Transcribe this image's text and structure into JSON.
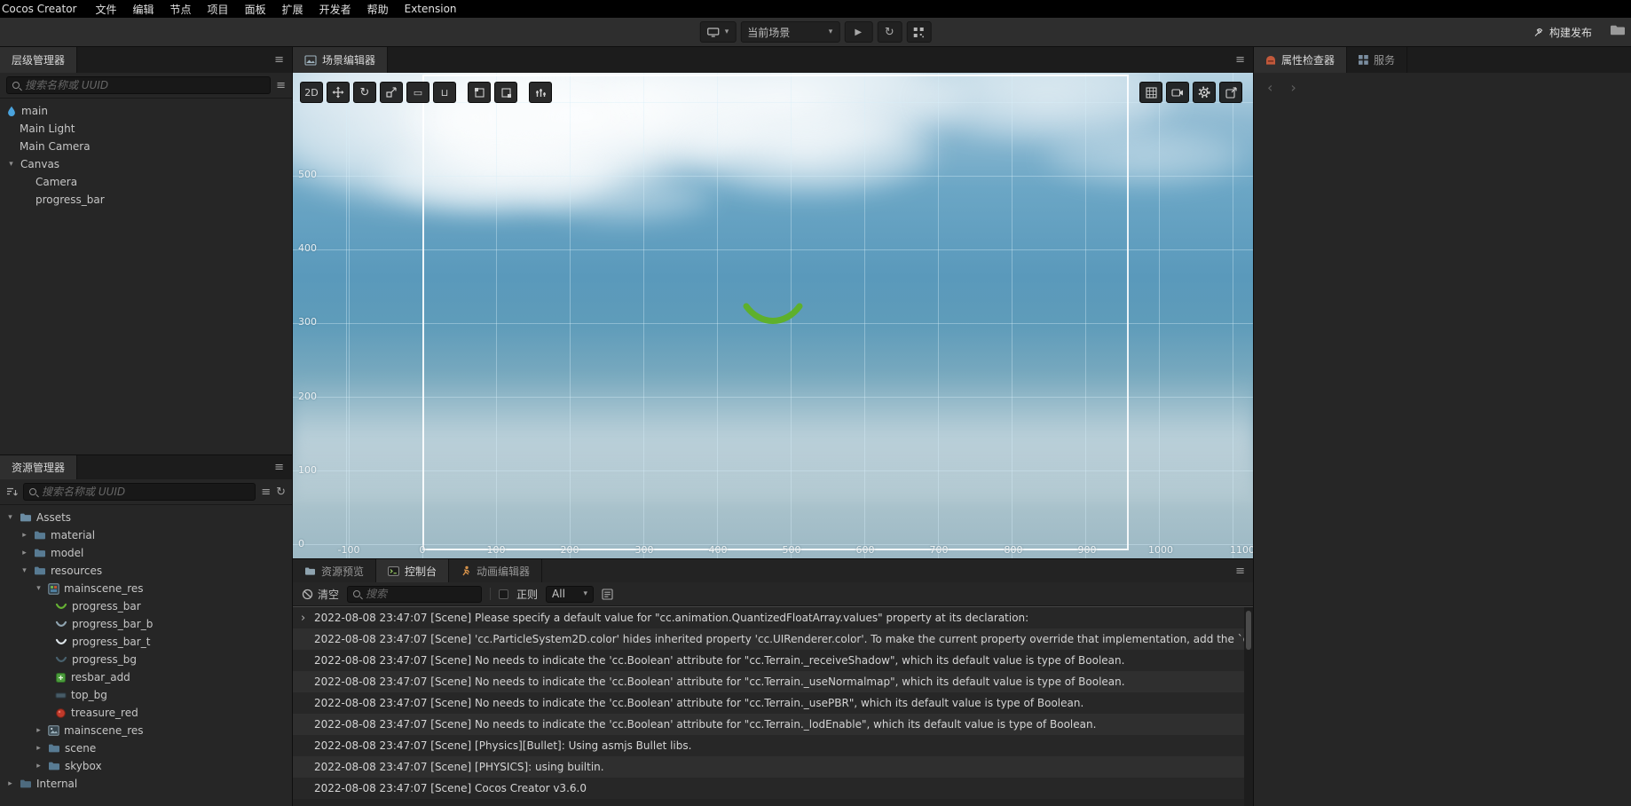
{
  "menubar": {
    "app_name": "Cocos Creator",
    "items": [
      "文件",
      "编辑",
      "节点",
      "项目",
      "面板",
      "扩展",
      "开发者",
      "帮助",
      "Extension"
    ]
  },
  "toolbar": {
    "scene_dropdown_value": "当前场景",
    "build_label": "构建发布"
  },
  "hierarchy": {
    "title": "层级管理器",
    "search_placeholder": "搜索名称或 UUID",
    "nodes": [
      "main",
      "Main Light",
      "Main Camera",
      "Canvas",
      "Camera",
      "progress_bar"
    ]
  },
  "assets": {
    "title": "资源管理器",
    "search_placeholder": "搜索名称或 UUID",
    "items": [
      "Assets",
      "material",
      "model",
      "resources",
      "mainscene_res",
      "progress_bar",
      "progress_bar_b",
      "progress_bar_t",
      "progress_bg",
      "resbar_add",
      "top_bg",
      "treasure_red",
      "mainscene_res",
      "scene",
      "skybox",
      "Internal"
    ]
  },
  "scene": {
    "tab_label": "场景编辑器",
    "mode_2d": "2D",
    "ruler_y": [
      "500",
      "400",
      "300",
      "200",
      "100",
      "0"
    ],
    "ruler_x": [
      "-100",
      "0",
      "100",
      "200",
      "300",
      "400",
      "500",
      "600",
      "700",
      "800",
      "900",
      "1000",
      "1100"
    ]
  },
  "console": {
    "tabs": [
      "资源预览",
      "控制台",
      "动画编辑器"
    ],
    "clear_label": "清空",
    "search_placeholder": "搜索",
    "regex_label": "正则",
    "filter_value": "All",
    "logs": [
      "2022-08-08 23:47:07 [Scene] Please specify a default value for \"cc.animation.QuantizedFloatArray.values\" property at its declaration:",
      "2022-08-08 23:47:07 [Scene] 'cc.ParticleSystem2D.color' hides inherited property 'cc.UIRenderer.color'. To make the current property override that implementation, add the `override: true` attribute plea",
      "2022-08-08 23:47:07 [Scene] No needs to indicate the 'cc.Boolean' attribute for \"cc.Terrain._receiveShadow\", which its default value is type of Boolean.",
      "2022-08-08 23:47:07 [Scene] No needs to indicate the 'cc.Boolean' attribute for \"cc.Terrain._useNormalmap\", which its default value is type of Boolean.",
      "2022-08-08 23:47:07 [Scene] No needs to indicate the 'cc.Boolean' attribute for \"cc.Terrain._usePBR\", which its default value is type of Boolean.",
      "2022-08-08 23:47:07 [Scene] No needs to indicate the 'cc.Boolean' attribute for \"cc.Terrain._lodEnable\", which its default value is type of Boolean.",
      "2022-08-08 23:47:07 [Scene] [Physics][Bullet]: Using asmjs Bullet libs.",
      "2022-08-08 23:47:07 [Scene] [PHYSICS]: using builtin.",
      "2022-08-08 23:47:07 [Scene] Cocos Creator v3.6.0"
    ]
  },
  "inspector": {
    "tabs": [
      "属性检查器",
      "服务"
    ]
  },
  "icons": {
    "hamburger": "≡",
    "chevron_down": "▾",
    "chevron_right": "▸",
    "play": "▶",
    "refresh": "↻",
    "nav_back": "‹",
    "nav_forward": "›",
    "expand_arrow": "›",
    "rect_tool": "▭",
    "u_tool": "⊔"
  },
  "colors": {
    "accent_green": "#5eb02c",
    "sky_blue": "#5b9abc",
    "panel_dark": "#262626"
  }
}
